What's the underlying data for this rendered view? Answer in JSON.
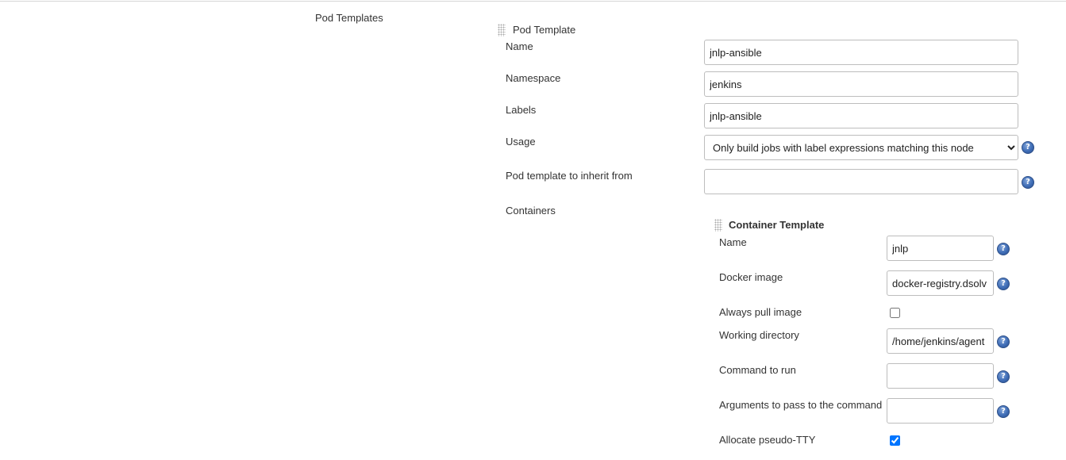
{
  "pod_templates": {
    "section_label": "Pod Templates",
    "pod_template": {
      "header": "Pod Template",
      "name": {
        "label": "Name",
        "value": "jnlp-ansible"
      },
      "namespace": {
        "label": "Namespace",
        "value": "jenkins"
      },
      "labels": {
        "label": "Labels",
        "value": "jnlp-ansible"
      },
      "usage": {
        "label": "Usage",
        "selected": "Only build jobs with label expressions matching this node"
      },
      "inherit_from": {
        "label": "Pod template to inherit from",
        "value": ""
      },
      "containers_label": "Containers",
      "container_template": {
        "header": "Container Template",
        "name": {
          "label": "Name",
          "value": "jnlp"
        },
        "docker_image": {
          "label": "Docker image",
          "value": "docker-registry.dsolv"
        },
        "always_pull": {
          "label": "Always pull image",
          "checked": false
        },
        "working_dir": {
          "label": "Working directory",
          "value": "/home/jenkins/agent"
        },
        "command": {
          "label": "Command to run",
          "value": ""
        },
        "arguments": {
          "label": "Arguments to pass to the command",
          "value": ""
        },
        "tty": {
          "label": "Allocate pseudo-TTY",
          "checked": true
        }
      }
    }
  },
  "help_glyph": "?",
  "icons": {
    "help": "help-icon",
    "drag": "drag-handle-icon"
  }
}
